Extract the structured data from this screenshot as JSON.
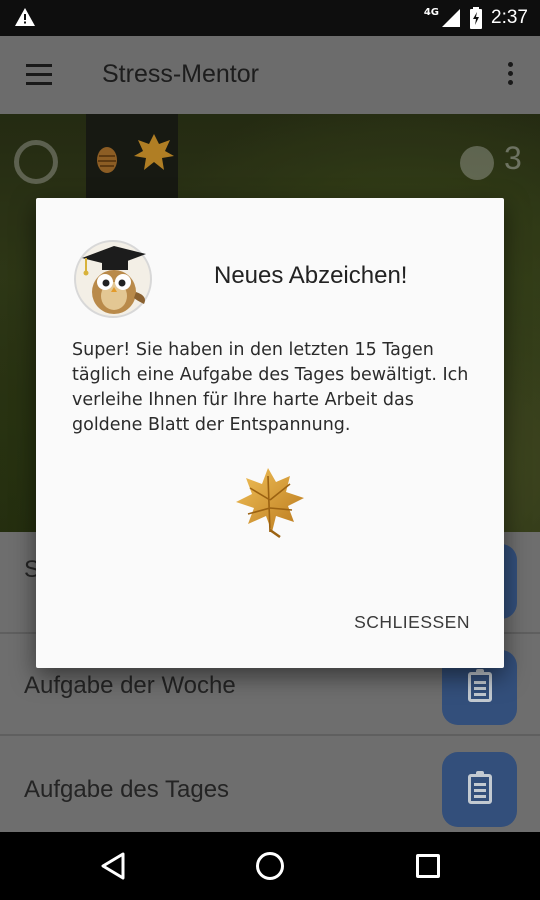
{
  "status_bar": {
    "network": "4G",
    "time": "2:37",
    "icons": [
      "warning-icon",
      "signal-icon",
      "battery-charging-icon"
    ]
  },
  "app_bar": {
    "title": "Stress-Mentor",
    "icons": [
      "menu-icon",
      "more-vert-icon"
    ]
  },
  "header": {
    "score": "3"
  },
  "list": {
    "items": [
      {
        "label": "S"
      },
      {
        "label": "Aufgabe der Woche"
      },
      {
        "label": "Aufgabe des Tages"
      }
    ],
    "accent": "#3b5a8c"
  },
  "dialog": {
    "title": "Neues Abzeichen!",
    "message": "Super! Sie haben in den letzten 15 Tagen täglich eine Aufgabe des Tages bewältigt. Ich verleihe Ihnen für Ihre harte Arbeit das goldene Blatt der Entspannung.",
    "close_label": "SCHLIESSEN",
    "badge_icon": "golden-leaf-icon",
    "avatar_icon": "owl-graduate-icon"
  },
  "nav_bar": {
    "icons": [
      "back-icon",
      "home-icon",
      "recents-icon"
    ]
  }
}
